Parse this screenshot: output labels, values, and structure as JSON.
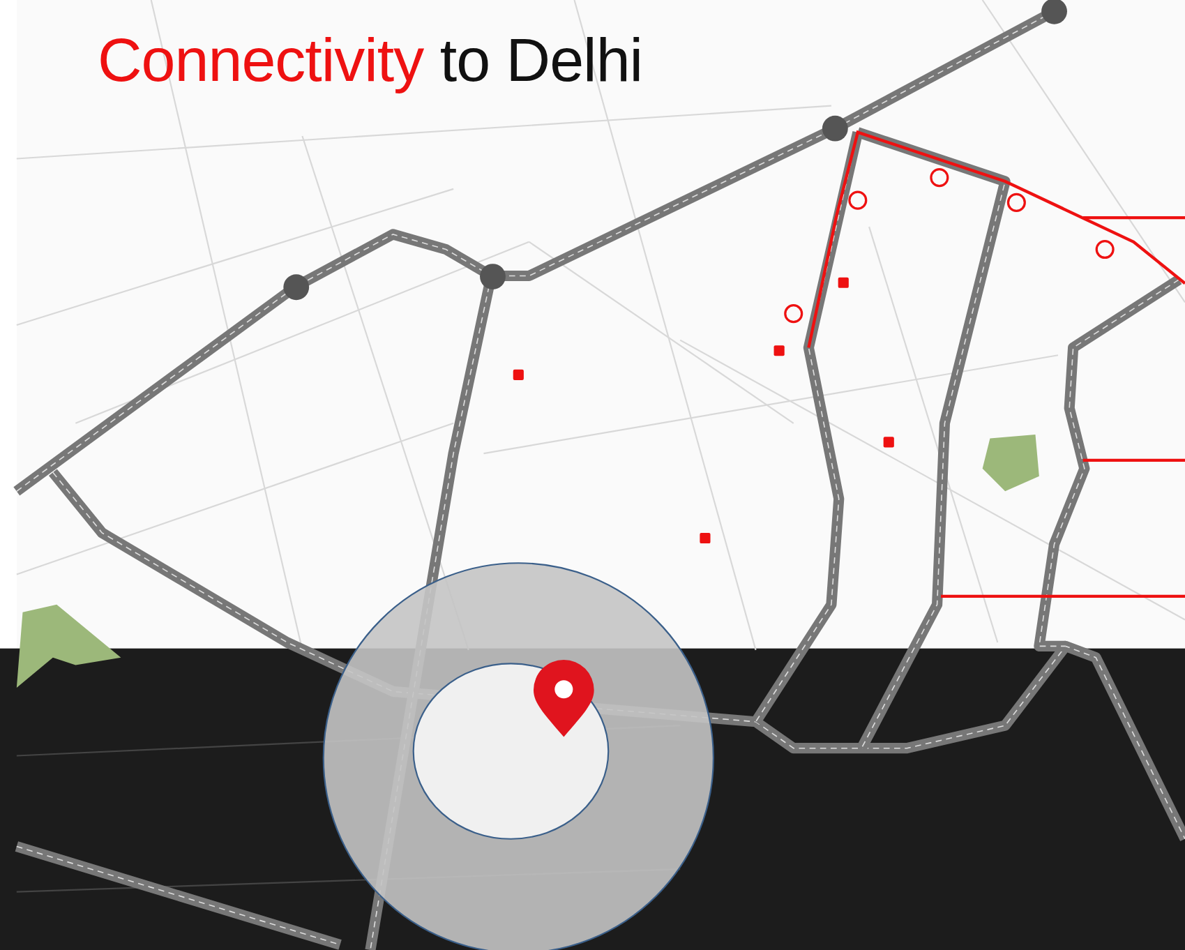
{
  "heading": {
    "highlight": "Connectivity",
    "text": "to Delhi"
  },
  "map": {
    "kind": "map"
  }
}
